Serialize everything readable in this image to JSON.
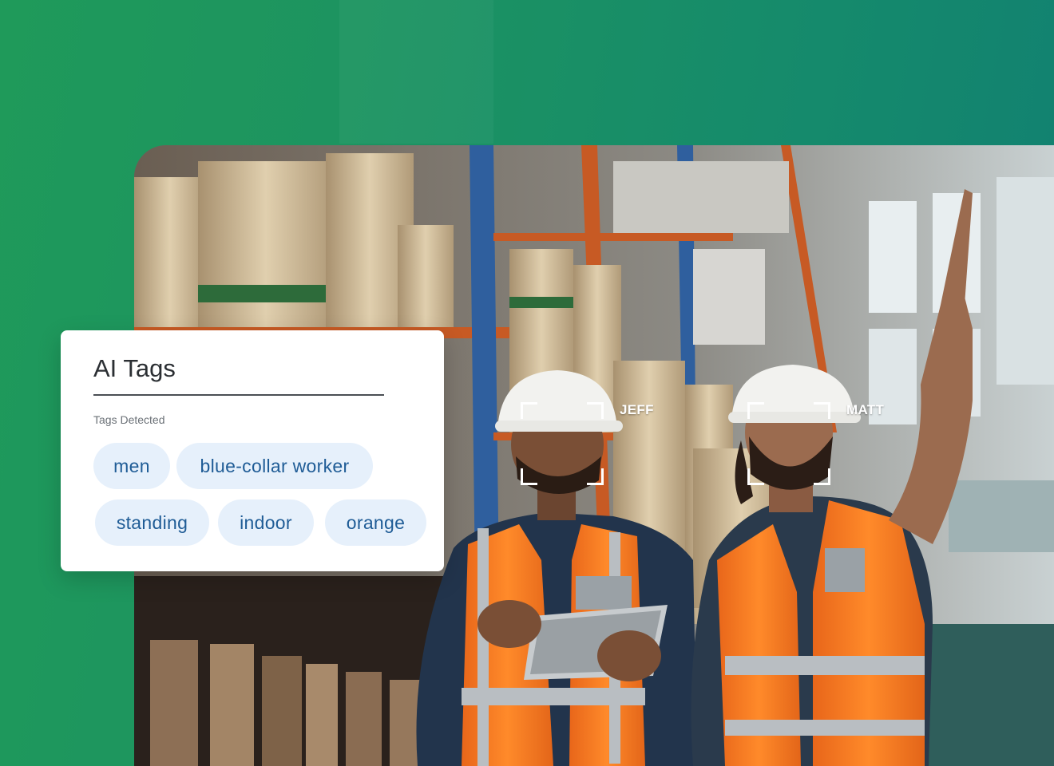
{
  "panel": {
    "title": "AI Tags",
    "subtitle": "Tags Detected",
    "tags": [
      "men",
      "blue-collar worker",
      "standing",
      "indoor",
      "orange"
    ]
  },
  "faces": [
    {
      "label": "JEFF"
    },
    {
      "label": "MATT"
    }
  ],
  "colors": {
    "background_green": "#1f9a5a",
    "background_teal": "#117f72",
    "chip_background": "#e6f0fb",
    "chip_text": "#1f5c96",
    "vest_orange": "#f07a1e"
  },
  "icons": [
    "face-detection-frame-icon"
  ]
}
